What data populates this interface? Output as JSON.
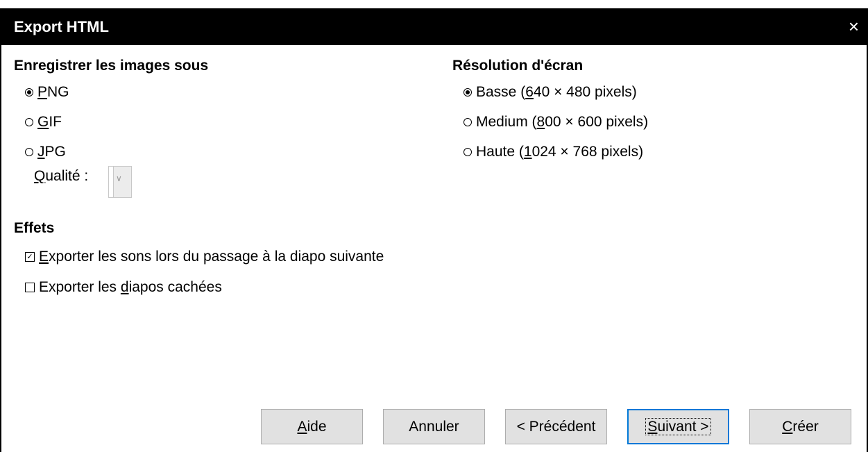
{
  "window": {
    "title": "Export HTML",
    "close_icon": "×"
  },
  "images": {
    "heading": "Enregistrer les images sous",
    "options": [
      {
        "pre": "",
        "key": "P",
        "post": "NG",
        "selected": true
      },
      {
        "pre": "",
        "key": "G",
        "post": "IF",
        "selected": false
      },
      {
        "pre": "",
        "key": "J",
        "post": "PG",
        "selected": false
      }
    ],
    "quality_label_key": "Q",
    "quality_label_rest": "ualité :"
  },
  "resolution": {
    "heading": "Résolution d'écran",
    "options": [
      {
        "pre": "Basse (",
        "key": "6",
        "post": "40 × 480 pixels)",
        "selected": true
      },
      {
        "pre": "Medium (",
        "key": "8",
        "post": "00 × 600 pixels)",
        "selected": false
      },
      {
        "pre": "Haute (",
        "key": "1",
        "post": "024 × 768 pixels)",
        "selected": false
      }
    ]
  },
  "effects": {
    "heading": "Effets",
    "sounds": {
      "pre": "",
      "key": "E",
      "post": "xporter les sons lors du passage à la diapo suivante",
      "checked": true
    },
    "hidden": {
      "pre": "Exporter les ",
      "key": "d",
      "post": "iapos cachées",
      "checked": false
    }
  },
  "buttons": {
    "help": {
      "key": "A",
      "rest": "ide"
    },
    "cancel": "Annuler",
    "previous": "< Précédent",
    "next": {
      "key": "S",
      "rest": "uivant >"
    },
    "create": {
      "key": "C",
      "rest": "réer"
    }
  }
}
